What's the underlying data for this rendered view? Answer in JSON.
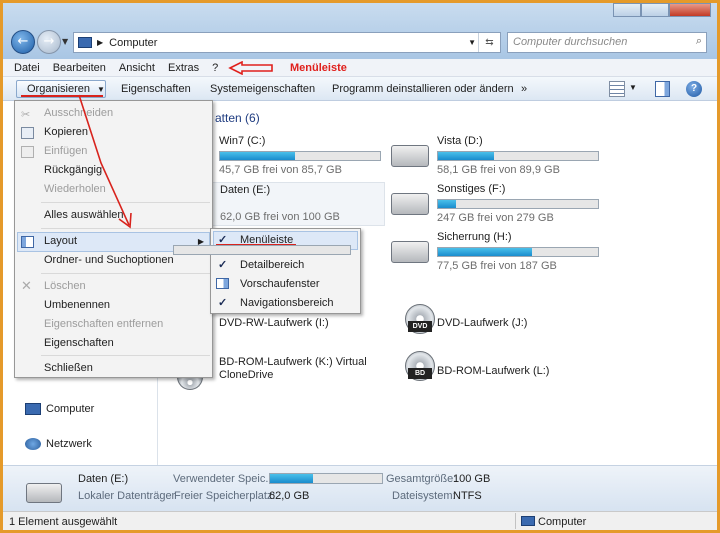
{
  "address": {
    "location": "Computer",
    "search_placeholder": "Computer durchsuchen"
  },
  "menubar": {
    "items": [
      "Datei",
      "Bearbeiten",
      "Ansicht",
      "Extras",
      "?"
    ],
    "annotation": "Menüleiste"
  },
  "toolbar": {
    "organize": "Organisieren",
    "items": [
      "Eigenschaften",
      "Systemeigenschaften",
      "Programm deinstallieren oder ändern"
    ],
    "more": "»"
  },
  "organize_menu": {
    "items": [
      {
        "label": "Ausschneiden",
        "enabled": false
      },
      {
        "label": "Kopieren",
        "enabled": true
      },
      {
        "label": "Einfügen",
        "enabled": false
      },
      {
        "label": "Rückgängig",
        "enabled": true
      },
      {
        "label": "Wiederholen",
        "enabled": false
      },
      {
        "label": "Alles auswählen",
        "enabled": true
      },
      {
        "label": "Layout",
        "enabled": true
      },
      {
        "label": "Ordner- und Suchoptionen",
        "enabled": true
      },
      {
        "label": "Löschen",
        "enabled": false
      },
      {
        "label": "Umbenennen",
        "enabled": true
      },
      {
        "label": "Eigenschaften entfernen",
        "enabled": false
      },
      {
        "label": "Eigenschaften",
        "enabled": true
      },
      {
        "label": "Schließen",
        "enabled": true
      }
    ]
  },
  "layout_submenu": {
    "items": [
      {
        "label": "Menüleiste",
        "checked": true
      },
      {
        "label": "Detailbereich",
        "checked": true
      },
      {
        "label": "Vorschaufenster",
        "checked": false
      },
      {
        "label": "Navigationsbereich",
        "checked": true
      }
    ]
  },
  "navpane": {
    "computer": "Computer",
    "network": "Netzwerk"
  },
  "content": {
    "group_title": "atten (6)",
    "drives": [
      {
        "name": "Win7 (C:)",
        "free": "45,7 GB frei von 85,7 GB",
        "used_fraction": 0.47
      },
      {
        "name": "Vista (D:)",
        "free": "58,1 GB frei von 89,9 GB",
        "used_fraction": 0.35
      },
      {
        "name": "Daten (E:)",
        "free": "62,0 GB frei von 100 GB",
        "used_fraction": 0.38
      },
      {
        "name": "Sonstiges (F:)",
        "free": "247 GB frei von 279 GB",
        "used_fraction": 0.11
      },
      {
        "name": "Sicherrung (H:)",
        "free": "77,5 GB frei von 187 GB",
        "used_fraction": 0.59
      }
    ],
    "optical": [
      {
        "name": "DVD-RW-Laufwerk (I:)",
        "tag": ""
      },
      {
        "name": "DVD-Laufwerk (J:)",
        "tag": "DVD"
      },
      {
        "name": "BD-ROM-Laufwerk (K:) Virtual",
        "name2": "CloneDrive",
        "tag": ""
      },
      {
        "name": "BD-ROM-Laufwerk (L:)",
        "tag": "BD"
      }
    ]
  },
  "details": {
    "name": "Daten (E:)",
    "type": "Lokaler Datenträger",
    "used_label": "Verwendeter Speic...",
    "used_fraction": 0.38,
    "free_label": "Freier Speicherplatz:",
    "free_value": "62,0 GB",
    "total_label": "Gesamtgröße:",
    "total_value": "100 GB",
    "fs_label": "Dateisystem:",
    "fs_value": "NTFS"
  },
  "status": {
    "selection": "1 Element ausgewählt",
    "location": "Computer"
  },
  "colors": {
    "annotation_red": "#e0201c",
    "bar_fill": "#1a8ccd",
    "frame": "#e59a2a"
  }
}
